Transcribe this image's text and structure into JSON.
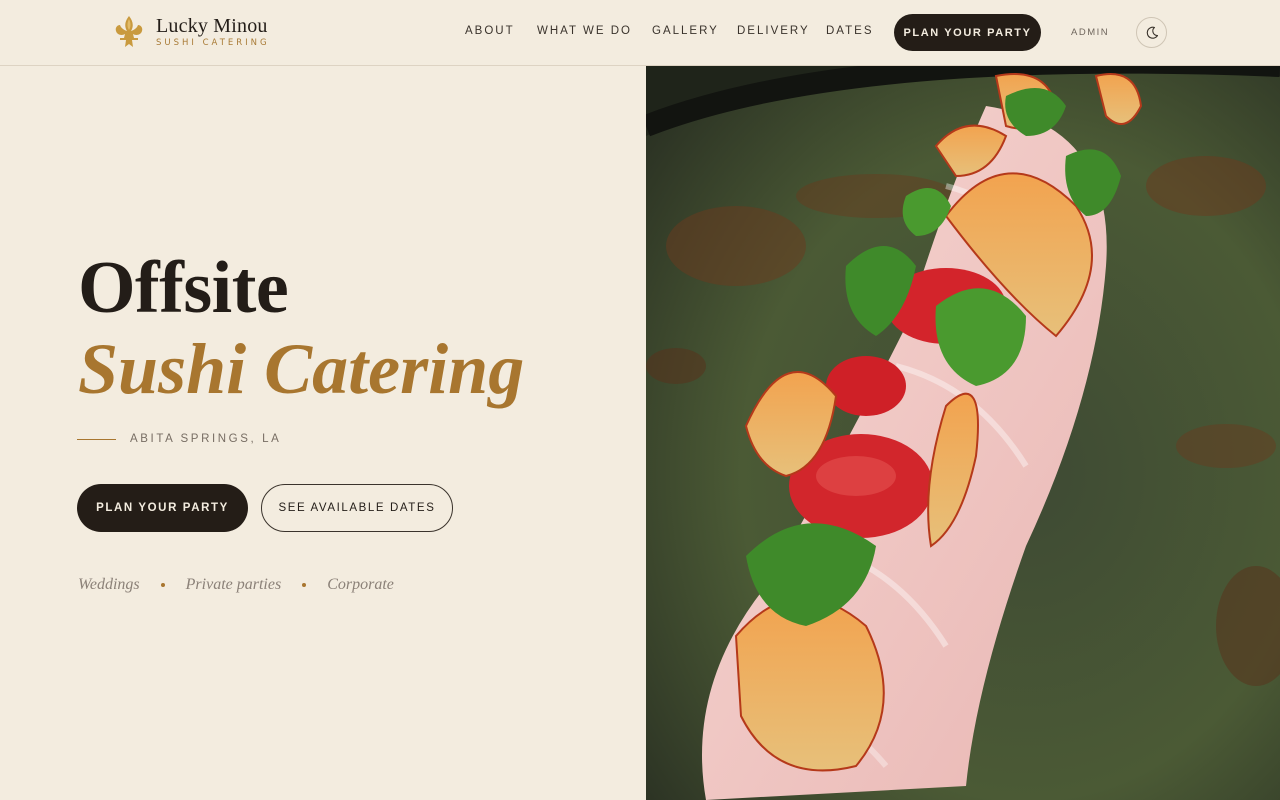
{
  "brand": {
    "name": "Lucky Minou",
    "tagline": "SUSHI CATERING",
    "logo_icon": "fleur-de-lis-icon",
    "accent_color": "#a8762f"
  },
  "nav": {
    "items": [
      "ABOUT",
      "WHAT WE DO",
      "GALLERY",
      "DELIVERY",
      "DATES"
    ],
    "cta_label": "PLAN YOUR PARTY",
    "admin_label": "ADMIN",
    "theme_icon": "moon-icon"
  },
  "hero": {
    "title_line1": "Offsite",
    "title_line2": "Sushi Catering",
    "location": "ABITA SPRINGS, LA",
    "primary_button": "PLAN YOUR PARTY",
    "secondary_button": "SEE AVAILABLE DATES",
    "tags": [
      "Weddings",
      "Private parties",
      "Corporate"
    ],
    "image_icon": "sushi-dish-photo"
  }
}
